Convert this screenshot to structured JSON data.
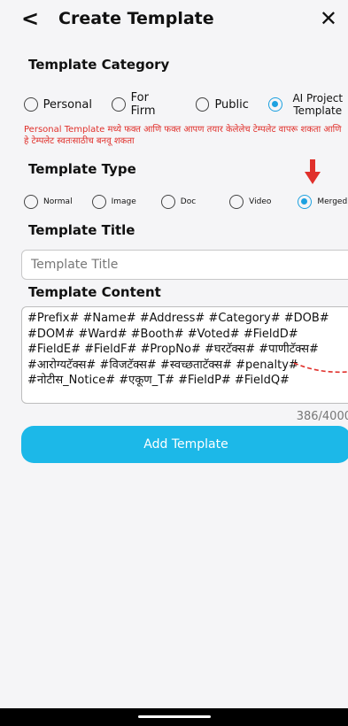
{
  "header": {
    "back_icon": "chevron-left-icon",
    "title": "Create Template",
    "close_icon": "close-icon"
  },
  "category": {
    "label": "Template Category",
    "options": [
      {
        "label": "Personal",
        "selected": false
      },
      {
        "label": "For Firm",
        "selected": false
      },
      {
        "label": "Public",
        "selected": false
      },
      {
        "label": "AI Project Template",
        "selected": true
      }
    ],
    "note": "Personal Template मध्ये फक्त आणि फक्त आपण तयार केलेलेच टेम्पलेट वापरू शकता आणि हे टेम्पलेट स्वतःसाठीच बनवू शकता",
    "note_color": "#e0302b"
  },
  "type": {
    "label": "Template Type",
    "options": [
      {
        "label": "Normal",
        "selected": false
      },
      {
        "label": "Image",
        "selected": false
      },
      {
        "label": "Doc",
        "selected": false
      },
      {
        "label": "Video",
        "selected": false
      },
      {
        "label": "Merged",
        "selected": true
      }
    ]
  },
  "title_field": {
    "label": "Template Title",
    "placeholder": "Template Title",
    "value": ""
  },
  "content": {
    "label": "Template Content",
    "value": "#Prefix# #Name# #Address# #Category# #DOB# #DOM# #Ward# #Booth# #Voted# #FieldD# #FieldE# #FieldF# #PropNo# #घरटॅक्स# #पाणीटॅक्स# #आरोग्यटॅक्स# #विजटॅक्स# #स्वच्छताटॅक्स# #penalty# #नोटीस_Notice# #एकूण_T# #FieldP# #FieldQ#",
    "counter": "386/4000"
  },
  "submit": {
    "label": "Add Template"
  },
  "colors": {
    "accent": "#1da1e0",
    "button": "#1cb8e8",
    "annotation": "#e0302b"
  }
}
